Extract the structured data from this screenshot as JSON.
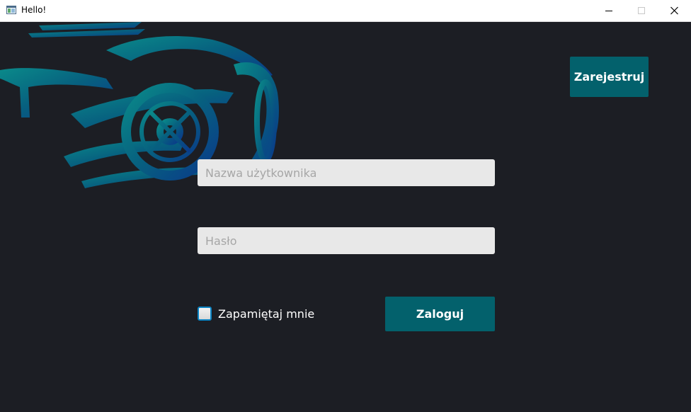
{
  "window": {
    "title": "Hello!",
    "icon": "app-window-icon"
  },
  "header": {
    "register_label": "Zarejestruj"
  },
  "form": {
    "username_placeholder": "Nazwa użytkownika",
    "username_value": "",
    "password_placeholder": "Hasło",
    "password_value": "",
    "remember_label": "Zapamiętaj mnie",
    "remember_checked": false,
    "login_label": "Zaloguj"
  },
  "colors": {
    "background": "#1c1e24",
    "accent": "#03616c",
    "input_bg": "#e8e8e8",
    "logo_teal": "#0a8a8a",
    "logo_blue": "#0a3a8a"
  }
}
